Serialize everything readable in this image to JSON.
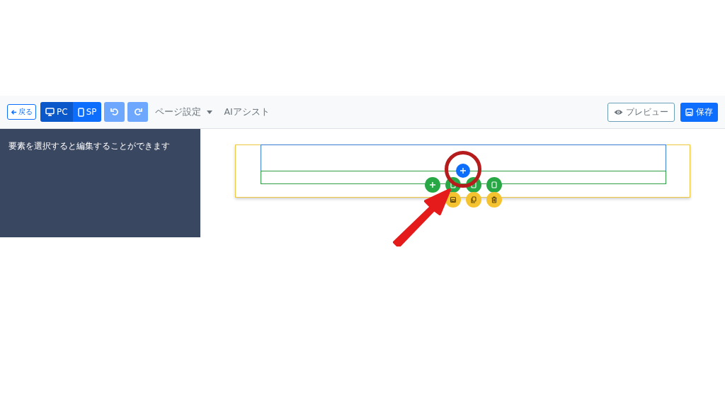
{
  "toolbar": {
    "back_button": "戻る",
    "devices": [
      {
        "label": "PC",
        "kind": "desktop",
        "selected": true
      },
      {
        "label": "SP",
        "kind": "phone",
        "selected": false
      }
    ],
    "history": [
      {
        "kind": "undo",
        "disabled": true
      },
      {
        "kind": "redo",
        "disabled": true
      }
    ],
    "menus": [
      {
        "label": "ページ設定",
        "kind": "dropdown"
      },
      {
        "label": "AIアシスト",
        "kind": "plain"
      }
    ],
    "preview_button": "プレビュー",
    "save_button": "保存"
  },
  "sidebar": {
    "hint": "要素を選択すると編集することができます"
  }
}
